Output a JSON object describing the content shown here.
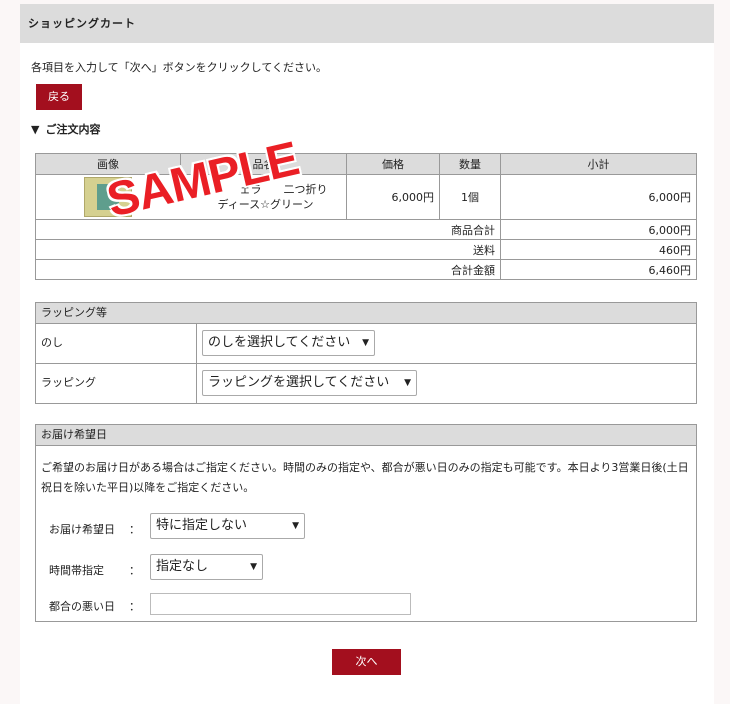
{
  "header": {
    "title": "ショッピングカート"
  },
  "instruction": "各項目を入力して「次へ」ボタンをクリックしてください。",
  "back_button": "戻る",
  "order": {
    "section_title": "ご注文内容",
    "columns": [
      "画像",
      "品名",
      "価格",
      "数量",
      "小計"
    ],
    "item": {
      "name_line1": "ト　　　　ェラ　　二つ折り",
      "name_line2": "　　　ディース☆グリーン",
      "price": "6,000円",
      "qty": "1個",
      "subtotal": "6,000円",
      "image_icon": "product-thumbnail"
    },
    "summary": [
      {
        "label": "商品合計",
        "value": "6,000円"
      },
      {
        "label": "送料",
        "value": "460円"
      },
      {
        "label": "合計金額",
        "value": "6,460円"
      }
    ],
    "watermark": "SAMPLE"
  },
  "wrapping": {
    "title": "ラッピング等",
    "noshi_label": "のし",
    "noshi_value": "のしを選択してください",
    "wrap_label": "ラッピング",
    "wrap_value": "ラッピングを選択してください"
  },
  "delivery": {
    "title": "お届け希望日",
    "description": "ご希望のお届け日がある場合はご指定ください。時間のみの指定や、都合が悪い日のみの指定も可能です。本日より3営業日後(土日祝日を除いた平日)以降をご指定ください。",
    "date_label": "お届け希望日",
    "date_value": "特に指定しない",
    "time_label": "時間帯指定",
    "time_value": "指定なし",
    "bad_day_label": "都合の悪い日",
    "bad_day_value": "",
    "colon": "："
  },
  "next_button": "次へ",
  "colors": {
    "accent": "#a30f1e",
    "header_bg": "#dcdcdc",
    "watermark": "#ea1f25"
  }
}
